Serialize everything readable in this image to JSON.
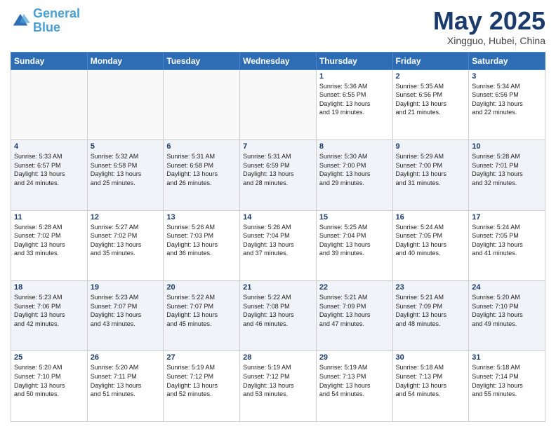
{
  "header": {
    "logo_general": "General",
    "logo_blue": "Blue",
    "title": "May 2025",
    "subtitle": "Xingguo, Hubei, China"
  },
  "weekdays": [
    "Sunday",
    "Monday",
    "Tuesday",
    "Wednesday",
    "Thursday",
    "Friday",
    "Saturday"
  ],
  "weeks": [
    [
      {
        "day": "",
        "info": "",
        "empty": true
      },
      {
        "day": "",
        "info": "",
        "empty": true
      },
      {
        "day": "",
        "info": "",
        "empty": true
      },
      {
        "day": "",
        "info": "",
        "empty": true
      },
      {
        "day": "1",
        "info": "Sunrise: 5:36 AM\nSunset: 6:55 PM\nDaylight: 13 hours\nand 19 minutes."
      },
      {
        "day": "2",
        "info": "Sunrise: 5:35 AM\nSunset: 6:56 PM\nDaylight: 13 hours\nand 21 minutes."
      },
      {
        "day": "3",
        "info": "Sunrise: 5:34 AM\nSunset: 6:56 PM\nDaylight: 13 hours\nand 22 minutes."
      }
    ],
    [
      {
        "day": "4",
        "info": "Sunrise: 5:33 AM\nSunset: 6:57 PM\nDaylight: 13 hours\nand 24 minutes."
      },
      {
        "day": "5",
        "info": "Sunrise: 5:32 AM\nSunset: 6:58 PM\nDaylight: 13 hours\nand 25 minutes."
      },
      {
        "day": "6",
        "info": "Sunrise: 5:31 AM\nSunset: 6:58 PM\nDaylight: 13 hours\nand 26 minutes."
      },
      {
        "day": "7",
        "info": "Sunrise: 5:31 AM\nSunset: 6:59 PM\nDaylight: 13 hours\nand 28 minutes."
      },
      {
        "day": "8",
        "info": "Sunrise: 5:30 AM\nSunset: 7:00 PM\nDaylight: 13 hours\nand 29 minutes."
      },
      {
        "day": "9",
        "info": "Sunrise: 5:29 AM\nSunset: 7:00 PM\nDaylight: 13 hours\nand 31 minutes."
      },
      {
        "day": "10",
        "info": "Sunrise: 5:28 AM\nSunset: 7:01 PM\nDaylight: 13 hours\nand 32 minutes."
      }
    ],
    [
      {
        "day": "11",
        "info": "Sunrise: 5:28 AM\nSunset: 7:02 PM\nDaylight: 13 hours\nand 33 minutes."
      },
      {
        "day": "12",
        "info": "Sunrise: 5:27 AM\nSunset: 7:02 PM\nDaylight: 13 hours\nand 35 minutes."
      },
      {
        "day": "13",
        "info": "Sunrise: 5:26 AM\nSunset: 7:03 PM\nDaylight: 13 hours\nand 36 minutes."
      },
      {
        "day": "14",
        "info": "Sunrise: 5:26 AM\nSunset: 7:04 PM\nDaylight: 13 hours\nand 37 minutes."
      },
      {
        "day": "15",
        "info": "Sunrise: 5:25 AM\nSunset: 7:04 PM\nDaylight: 13 hours\nand 39 minutes."
      },
      {
        "day": "16",
        "info": "Sunrise: 5:24 AM\nSunset: 7:05 PM\nDaylight: 13 hours\nand 40 minutes."
      },
      {
        "day": "17",
        "info": "Sunrise: 5:24 AM\nSunset: 7:05 PM\nDaylight: 13 hours\nand 41 minutes."
      }
    ],
    [
      {
        "day": "18",
        "info": "Sunrise: 5:23 AM\nSunset: 7:06 PM\nDaylight: 13 hours\nand 42 minutes."
      },
      {
        "day": "19",
        "info": "Sunrise: 5:23 AM\nSunset: 7:07 PM\nDaylight: 13 hours\nand 43 minutes."
      },
      {
        "day": "20",
        "info": "Sunrise: 5:22 AM\nSunset: 7:07 PM\nDaylight: 13 hours\nand 45 minutes."
      },
      {
        "day": "21",
        "info": "Sunrise: 5:22 AM\nSunset: 7:08 PM\nDaylight: 13 hours\nand 46 minutes."
      },
      {
        "day": "22",
        "info": "Sunrise: 5:21 AM\nSunset: 7:09 PM\nDaylight: 13 hours\nand 47 minutes."
      },
      {
        "day": "23",
        "info": "Sunrise: 5:21 AM\nSunset: 7:09 PM\nDaylight: 13 hours\nand 48 minutes."
      },
      {
        "day": "24",
        "info": "Sunrise: 5:20 AM\nSunset: 7:10 PM\nDaylight: 13 hours\nand 49 minutes."
      }
    ],
    [
      {
        "day": "25",
        "info": "Sunrise: 5:20 AM\nSunset: 7:10 PM\nDaylight: 13 hours\nand 50 minutes."
      },
      {
        "day": "26",
        "info": "Sunrise: 5:20 AM\nSunset: 7:11 PM\nDaylight: 13 hours\nand 51 minutes."
      },
      {
        "day": "27",
        "info": "Sunrise: 5:19 AM\nSunset: 7:12 PM\nDaylight: 13 hours\nand 52 minutes."
      },
      {
        "day": "28",
        "info": "Sunrise: 5:19 AM\nSunset: 7:12 PM\nDaylight: 13 hours\nand 53 minutes."
      },
      {
        "day": "29",
        "info": "Sunrise: 5:19 AM\nSunset: 7:13 PM\nDaylight: 13 hours\nand 54 minutes."
      },
      {
        "day": "30",
        "info": "Sunrise: 5:18 AM\nSunset: 7:13 PM\nDaylight: 13 hours\nand 54 minutes."
      },
      {
        "day": "31",
        "info": "Sunrise: 5:18 AM\nSunset: 7:14 PM\nDaylight: 13 hours\nand 55 minutes."
      }
    ]
  ]
}
